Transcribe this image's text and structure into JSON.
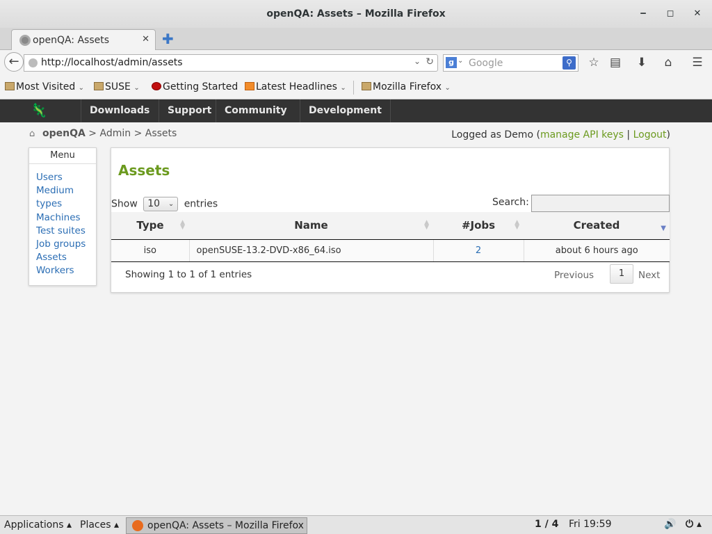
{
  "window": {
    "title": "openQA: Assets – Mozilla Firefox"
  },
  "tab": {
    "title": "openQA: Assets"
  },
  "nav": {
    "url": "http://localhost/admin/assets",
    "search_placeholder": "Google"
  },
  "bookmarks": [
    "Most Visited",
    "SUSE",
    "Getting Started",
    "Latest Headlines",
    "Mozilla Firefox"
  ],
  "site_nav": [
    "Downloads",
    "Support",
    "Community",
    "Development"
  ],
  "breadcrumb": {
    "root": "openQA",
    "sep1": ">",
    "admin": "Admin",
    "sep2": ">",
    "current": "Assets"
  },
  "login": {
    "prefix": "Logged as Demo (",
    "api": "manage API keys",
    "sep": "|",
    "logout": "Logout",
    "suffix": ")"
  },
  "menu": {
    "title": "Menu",
    "items": [
      "Users",
      "Medium",
      "types",
      "Machines",
      "Test suites",
      "Job groups",
      "Assets",
      "Workers"
    ]
  },
  "assets": {
    "title": "Assets",
    "show": "Show",
    "entries_value": "10",
    "entries": "entries",
    "search": "Search:",
    "columns": [
      "Type",
      "Name",
      "#Jobs",
      "Created"
    ],
    "rows": [
      [
        "iso",
        "openSUSE-13.2-DVD-x86_64.iso",
        "2",
        "about 6 hours ago"
      ]
    ],
    "info": "Showing 1 to 1 of 1 entries",
    "prev": "Previous",
    "page": "1",
    "next": "Next"
  },
  "taskbar": {
    "applications": "Applications ▴",
    "places": "Places ▴",
    "window": "openQA: Assets – Mozilla Firefox",
    "workspace": "1 / 4",
    "clock": "Fri 19:59"
  }
}
